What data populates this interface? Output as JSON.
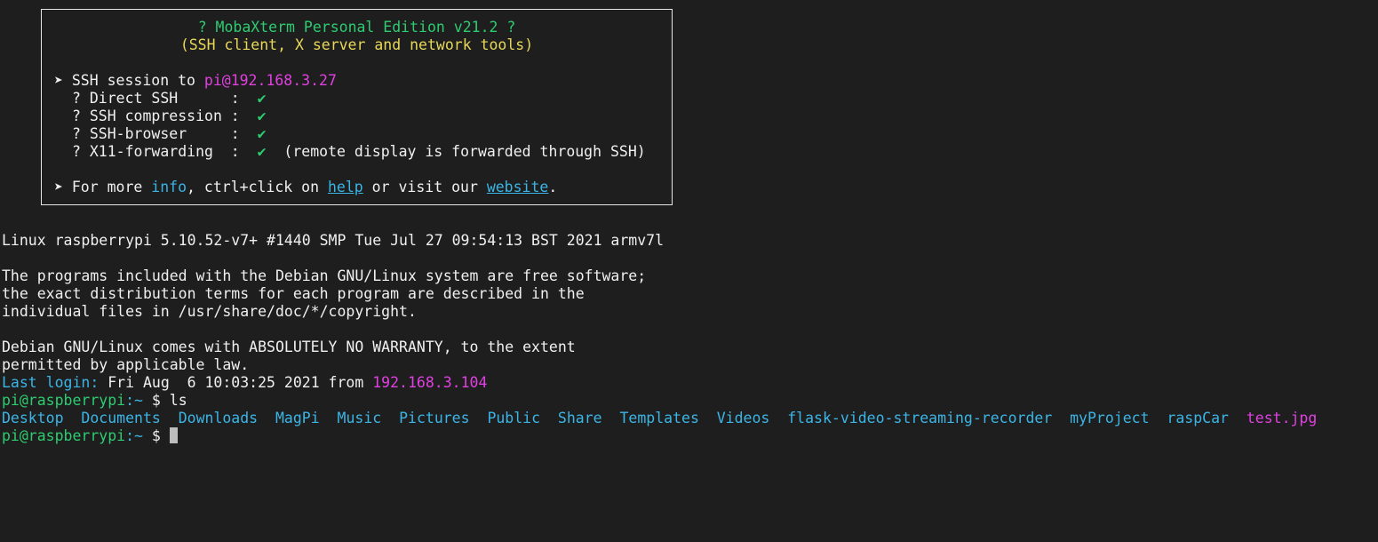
{
  "banner": {
    "title_line": "? MobaXterm Personal Edition v21.2 ?",
    "subtitle_line": "(SSH client, X server and network tools)",
    "session_prefix": "➤ SSH session to ",
    "session_target": "pi@192.168.3.27",
    "features": [
      {
        "label": "? Direct SSH      :  ",
        "status": "✔",
        "note": ""
      },
      {
        "label": "? SSH compression :  ",
        "status": "✔",
        "note": ""
      },
      {
        "label": "? SSH-browser     :  ",
        "status": "✔",
        "note": ""
      },
      {
        "label": "? X11-forwarding  :  ",
        "status": "✔",
        "note": "  (remote display is forwarded through SSH)"
      }
    ],
    "more_prefix": "➤ For more ",
    "more_info": "info",
    "more_mid": ", ctrl+click on ",
    "more_help": "help",
    "more_mid2": " or visit our ",
    "more_website": "website",
    "more_end": "."
  },
  "terminal": {
    "uname": "Linux raspberrypi 5.10.52-v7+ #1440 SMP Tue Jul 27 09:54:13 BST 2021 armv7l",
    "motd": [
      "The programs included with the Debian GNU/Linux system are free software;",
      "the exact distribution terms for each program are described in the",
      "individual files in /usr/share/doc/*/copyright.",
      "",
      "Debian GNU/Linux comes with ABSOLUTELY NO WARRANTY, to the extent",
      "permitted by applicable law."
    ],
    "last_login_label": "Last login:",
    "last_login_value": " Fri Aug  6 10:03:25 2021 from ",
    "last_login_ip": "192.168.3.104",
    "prompt_user": "pi@raspberrypi",
    "prompt_path": ":~",
    "prompt_symbol": " $ ",
    "command": "ls",
    "directories": [
      "Desktop",
      "Documents",
      "Downloads",
      "MagPi",
      "Music",
      "Pictures",
      "Public",
      "Share",
      "Templates",
      "Videos",
      "flask-video-streaming-recorder",
      "myProject",
      "raspCar"
    ],
    "files": [
      "test.jpg"
    ]
  },
  "colors": {
    "background": "#1e1e1e",
    "text": "#f0f0f0",
    "green": "#2ecc71",
    "yellow": "#e8d85a",
    "magenta": "#e040e0",
    "cyan": "#3bb5e6"
  }
}
